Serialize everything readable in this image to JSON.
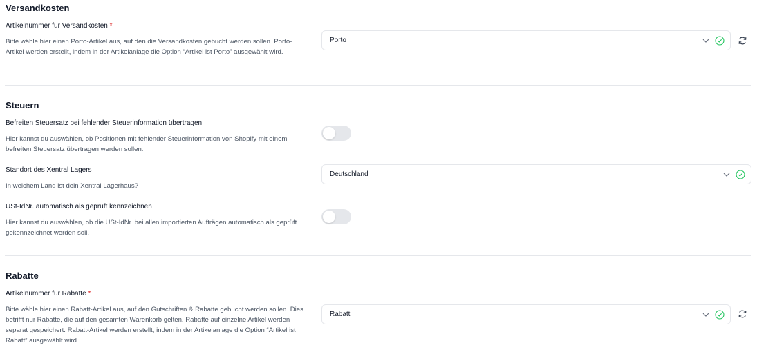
{
  "colors": {
    "accent_green": "#22c55e",
    "required": "#dc2626",
    "divider": "#e5e7eb",
    "toggle_off": "#e5e7eb"
  },
  "shipping": {
    "title": "Versandkosten",
    "label": "Artikelnummer für Versandkosten",
    "required_mark": "*",
    "description": "Bitte wähle hier einen Porto-Artikel aus, auf den die Versandkosten gebucht werden sollen. Porto-Artikel werden erstellt, indem in der Artikelanlage die Option “Artikel ist Porto” ausgewählt wird.",
    "select_value": "Porto"
  },
  "taxes": {
    "title": "Steuern",
    "exempt": {
      "label": "Befreiten Steuersatz bei fehlender Steuerinformation übertragen",
      "description": "Hier kannst du auswählen, ob Positionen mit fehlender Steuerinformation von Shopify mit einem befreiten Steuersatz übertragen werden sollen.",
      "enabled": false
    },
    "warehouse": {
      "label": "Standort des Xentral Lagers",
      "description": "In welchem Land ist dein Xentral Lagerhaus?",
      "select_value": "Deutschland"
    },
    "vat_id": {
      "label": "USt-IdNr. automatisch als geprüft kennzeichnen",
      "description": "Hier kannst du auswählen, ob die USt-IdNr. bei allen importierten Aufträgen automatisch als geprüft gekennzeichnet werden soll.",
      "enabled": false
    }
  },
  "discounts": {
    "title": "Rabatte",
    "label": "Artikelnummer für Rabatte",
    "required_mark": "*",
    "description": "Bitte wähle hier einen Rabatt-Artikel aus, auf den Gutschriften & Rabatte gebucht werden sollen. Dies betrifft nur Rabatte, die auf den gesamten Warenkorb gelten. Rabatte auf einzelne Artikel werden separat gespeichert. Rabatt-Artikel werden erstellt, indem in der Artikelanlage die Option “Artikel ist Rabatt” ausgewählt wird.",
    "select_value": "Rabatt"
  },
  "icons": {
    "dropdown": "chevron-down-icon",
    "valid": "check-circle-icon",
    "refresh": "refresh-icon"
  }
}
